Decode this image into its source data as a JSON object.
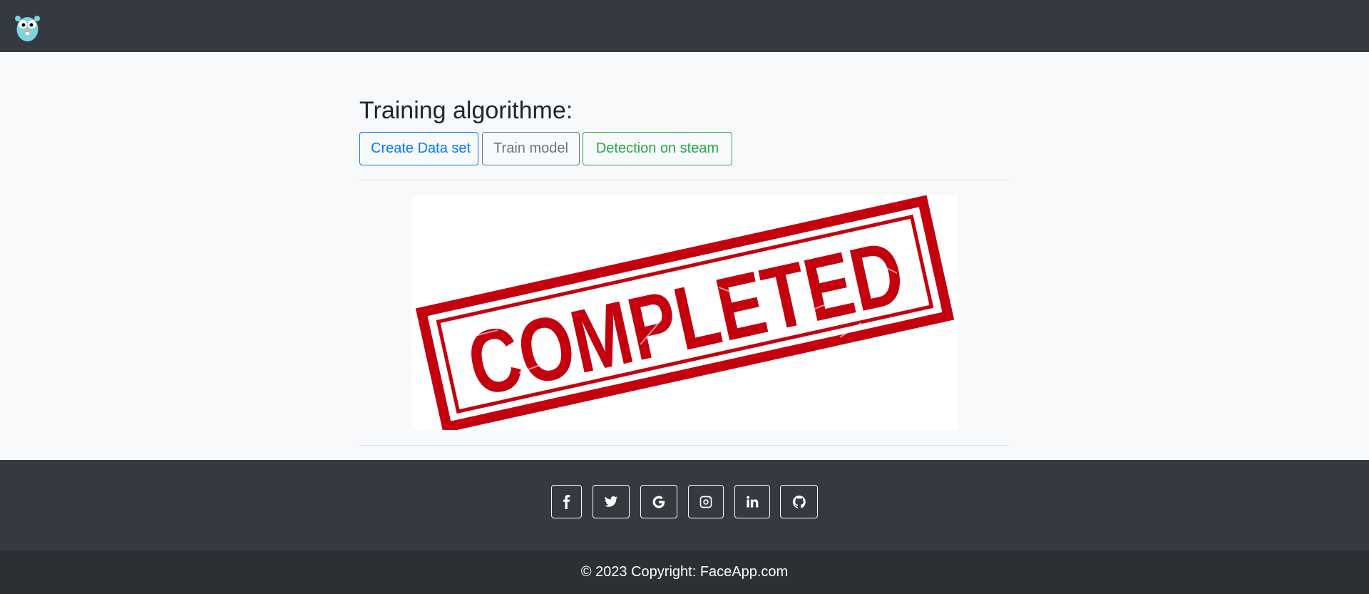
{
  "navbar": {
    "logo_icon": "gopher-logo-icon"
  },
  "main": {
    "title": "Training algorithme:",
    "buttons": {
      "create_dataset": "Create Data set",
      "train_model": "Train model",
      "detection": "Detection on steam"
    },
    "image": {
      "stamp_text": "COMPLETED",
      "stamp_color": "#c4000f"
    }
  },
  "footer": {
    "social_icons": [
      "facebook-icon",
      "twitter-icon",
      "google-icon",
      "instagram-icon",
      "linkedin-icon",
      "github-icon"
    ],
    "copyright": "© 2023 Copyright: FaceApp.com"
  },
  "colors": {
    "navbar_bg": "#343a40",
    "copyright_bg": "#2c3034",
    "primary": "#007bff",
    "secondary": "#6c757d",
    "success": "#28a745"
  }
}
